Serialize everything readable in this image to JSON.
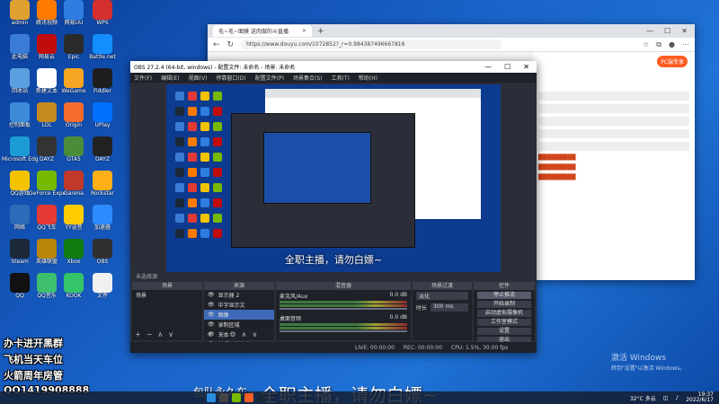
{
  "desktop": {
    "columns": [
      [
        {
          "label": "admin",
          "color": "#e0a030"
        },
        {
          "label": "此电脑",
          "color": "#3a7bd5"
        },
        {
          "label": "回收站",
          "color": "#5aa0e0"
        },
        {
          "label": "控制面板",
          "color": "#3b8bd9"
        },
        {
          "label": "Microsoft Edge",
          "color": "#1d9bd4"
        },
        {
          "label": "QQ游戏",
          "color": "#f3c300"
        },
        {
          "label": "网络",
          "color": "#2d6ab8"
        },
        {
          "label": "Steam",
          "color": "#1b2838"
        },
        {
          "label": "QQ",
          "color": "#111111"
        }
      ],
      [
        {
          "label": "腾讯视频",
          "color": "#ff7b00"
        },
        {
          "label": "网易云",
          "color": "#c20c0c"
        },
        {
          "label": "新建文本",
          "color": "#ffffff"
        },
        {
          "label": "LOL",
          "color": "#c48a1f"
        },
        {
          "label": "DAYZ",
          "color": "#333333"
        },
        {
          "label": "GeForce Experience",
          "color": "#76b900"
        },
        {
          "label": "QQ飞车",
          "color": "#e53935"
        },
        {
          "label": "英雄联盟",
          "color": "#b8860b"
        },
        {
          "label": "QQ音乐",
          "color": "#3dbf6f"
        }
      ],
      [
        {
          "label": "网易UU",
          "color": "#2f7de1"
        },
        {
          "label": "Epic",
          "color": "#2a2a2a"
        },
        {
          "label": "WeGame",
          "color": "#f5a623"
        },
        {
          "label": "Origin",
          "color": "#f56c2d"
        },
        {
          "label": "GTA5",
          "color": "#4a8c3a"
        },
        {
          "label": "Garena",
          "color": "#c0392b"
        },
        {
          "label": "YY语音",
          "color": "#ffcc00"
        },
        {
          "label": "Xbox",
          "color": "#107c10"
        },
        {
          "label": "KOOK",
          "color": "#35c46a"
        }
      ],
      [
        {
          "label": "WPS",
          "color": "#d32f2f"
        },
        {
          "label": "Battle.net",
          "color": "#148eff"
        },
        {
          "label": "Fiddler",
          "color": "#1e1e1e"
        },
        {
          "label": "UPlay",
          "color": "#0070ff"
        },
        {
          "label": "DAYZ",
          "color": "#222222"
        },
        {
          "label": "Rockstar",
          "color": "#fcaf17"
        },
        {
          "label": "加速器",
          "color": "#2e8bff"
        },
        {
          "label": "OBS",
          "color": "#303030"
        },
        {
          "label": "文件",
          "color": "#f0f0f0"
        }
      ]
    ]
  },
  "browser": {
    "tab_title": "毛~毛~面膜 送肉做的斗直播",
    "url": "https://www.douyu.com/1072852?_r=0.984387496667816",
    "pc_button": "PC端专享"
  },
  "obs": {
    "title": "OBS 27.2.4 (64-bit, windows) - 配置文件: 未命名 - 场景: 未命名",
    "menu": [
      "文件(F)",
      "编辑(E)",
      "视图(V)",
      "停靠窗口(D)",
      "配置文件(P)",
      "场景集合(S)",
      "工具(T)",
      "帮助(H)"
    ],
    "preview_caption": "全职主播，请勿白嫖~",
    "unselected_source": "未选择源",
    "docks": {
      "scenes": {
        "title": "场景",
        "items": [
          "场景"
        ]
      },
      "sources": {
        "title": "来源",
        "items": [
          "显示器 2",
          "中字显示文",
          "图像",
          "录制区域",
          "文本",
          "编辑器前文本"
        ]
      },
      "mixer": {
        "title": "混音器",
        "channels": [
          {
            "name": "麦克风/Aux",
            "db": "0.0 dB"
          },
          {
            "name": "桌面音频",
            "db": "0.0 dB"
          }
        ]
      },
      "transitions": {
        "title": "场景过渡",
        "type": "淡化",
        "duration_label": "时长",
        "duration": "300 ms"
      },
      "controls": {
        "title": "控件",
        "buttons": [
          "停止推流",
          "开始录制",
          "启动虚拟摄像机",
          "工作室模式",
          "设置",
          "退出"
        ]
      }
    },
    "status": {
      "live": "LIVE: 00:00:00",
      "rec": "REC: 00:00:00",
      "cpu": "CPU: 1.5%, 30.00 fps"
    }
  },
  "overlays": {
    "lines": [
      "办卡进开黑群",
      "飞机当天车位",
      "火箭周年房管",
      "QQ1419908888"
    ],
    "small_caption": "包队永久车~",
    "big_caption": "全职主播，请勿白嫖~"
  },
  "watermark": {
    "title": "激活 Windows",
    "subtitle": "转到\"设置\"以激活 Windows。"
  },
  "taskbar": {
    "weather": "32°C 多云",
    "time": "19:37",
    "date": "2022/6/17"
  }
}
